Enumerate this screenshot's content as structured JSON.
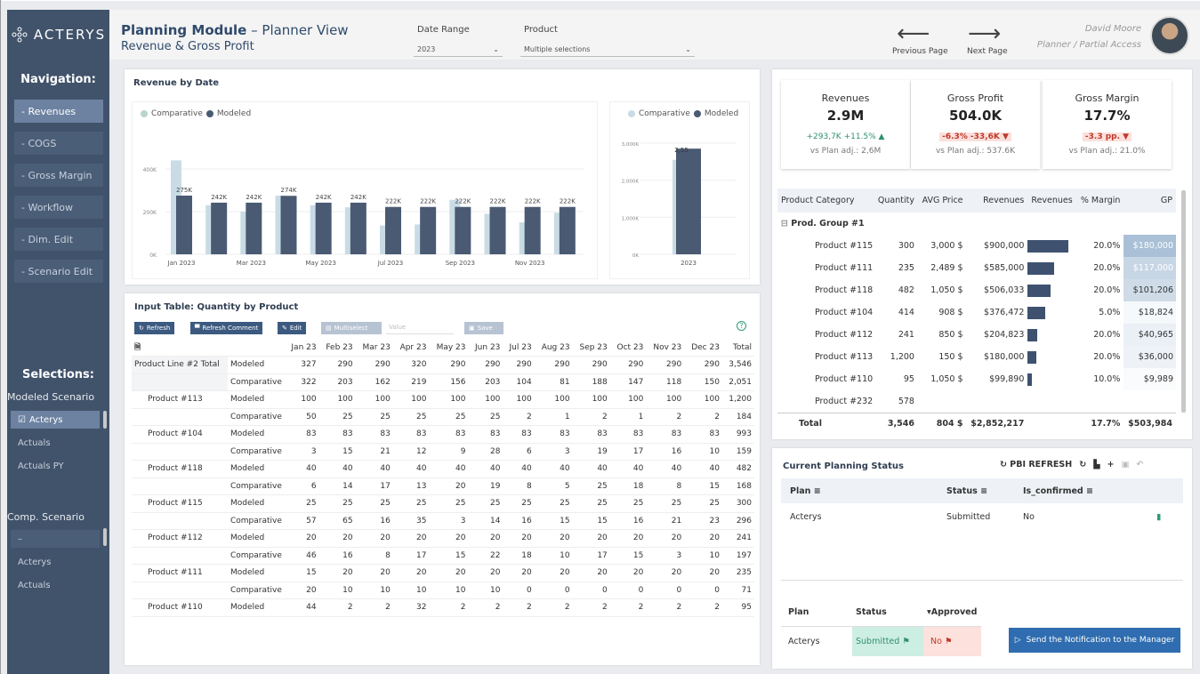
{
  "brand": {
    "name": "ACTERYS"
  },
  "header": {
    "title_bold": "Planning Module",
    "title_rest": " – Planner View",
    "subtitle": "Revenue & Gross Profit",
    "date_label": "Date Range",
    "date_value": "2023",
    "product_label": "Product",
    "product_value": "Multiple selections",
    "prev_label": "Previous Page",
    "next_label": "Next Page",
    "user_name": "David Moore",
    "user_role": "Planner / Partial Access"
  },
  "sidebar": {
    "nav_title": "Navigation:",
    "items": [
      "- Revenues",
      "- COGS",
      "- Gross Margin",
      "- Workflow",
      "- Dim. Edit",
      "- Scenario Edit"
    ],
    "sel_title": "Selections:",
    "modeled_label": "Modeled Scenario",
    "modeled_items": [
      "Acterys",
      "Actuals",
      "Actuals PY"
    ],
    "comp_label": "Comp. Scenario",
    "comp_items": [
      "–",
      "Acterys",
      "Actuals"
    ]
  },
  "revenue_chart": {
    "title": "Revenue by Date",
    "legend_comp": "Comparative",
    "legend_model": "Modeled"
  },
  "chart_data": [
    {
      "type": "bar",
      "title": "Revenue by Date",
      "categories": [
        "Jan 2023",
        "Feb 2023",
        "Mar 2023",
        "Apr 2023",
        "May 2023",
        "Jun 2023",
        "Jul 2023",
        "Aug 2023",
        "Sep 2023",
        "Oct 2023",
        "Nov 2023",
        "Dec 2023"
      ],
      "x_tick_labels": [
        "Jan 2023",
        "Mar 2023",
        "May 2023",
        "Jul 2023",
        "Sep 2023",
        "Nov 2023"
      ],
      "y_tick_labels": [
        "0K",
        "200K",
        "400K"
      ],
      "ylim": [
        0,
        500
      ],
      "series": [
        {
          "name": "Comparative",
          "color": "#c9dce6",
          "values": [
            440,
            230,
            200,
            275,
            230,
            220,
            135,
            140,
            255,
            190,
            150,
            195
          ]
        },
        {
          "name": "Modeled",
          "color": "#4a5a72",
          "values": [
            275,
            242,
            242,
            274,
            242,
            242,
            222,
            222,
            222,
            222,
            222,
            222
          ]
        }
      ],
      "data_labels": [
        "275K",
        "242K",
        "242K",
        "274K",
        "242K",
        "242K",
        "222K",
        "222K",
        "222K",
        "222K",
        "222K",
        "222K"
      ]
    },
    {
      "type": "bar",
      "categories": [
        "2023"
      ],
      "y_tick_labels": [
        "0K",
        "1,000K",
        "2,000K",
        "3,000K"
      ],
      "ylim": [
        0,
        3000
      ],
      "series": [
        {
          "name": "Comparative",
          "color": "#c9dce6",
          "values": [
            2550
          ]
        },
        {
          "name": "Modeled",
          "color": "#4a5a72",
          "values": [
            2852
          ]
        }
      ],
      "data_labels": [
        "2,55"
      ]
    }
  ],
  "kpis": [
    {
      "title": "Revenues",
      "value": "2.9M",
      "delta": "+293,7K +11.5% ▲",
      "plan": "vs Plan adj.: 2,6M",
      "dir": "up"
    },
    {
      "title": "Gross Profit",
      "value": "504.0K",
      "delta": "-6.3% -33,6K ▼",
      "plan": "vs Plan adj.: 537.6K",
      "dir": "down"
    },
    {
      "title": "Gross Margin",
      "value": "17.7%",
      "delta": "-3.3 pp.  ▼",
      "plan": "vs Plan adj.: 21.0%",
      "dir": "down"
    }
  ],
  "product_table": {
    "headers": [
      "Product Category",
      "Quantity",
      "AVG Price",
      "Revenues",
      "Revenues",
      "% Margin",
      "GP"
    ],
    "group": "Prod. Group #1",
    "rows": [
      [
        "Product #115",
        "300",
        "3,000 $",
        "$900,000",
        1.0,
        "20.0%",
        "$180,000",
        1.0
      ],
      [
        "Product #111",
        "235",
        "2,489 $",
        "$585,000",
        0.65,
        "20.0%",
        "$117,000",
        0.65
      ],
      [
        "Product #118",
        "482",
        "1,050 $",
        "$506,033",
        0.56,
        "20.0%",
        "$101,206",
        0.56
      ],
      [
        "Product #104",
        "414",
        "908 $",
        "$376,472",
        0.42,
        "5.0%",
        "$18,824",
        0.1
      ],
      [
        "Product #112",
        "241",
        "850 $",
        "$204,823",
        0.23,
        "20.0%",
        "$40,965",
        0.23
      ],
      [
        "Product #113",
        "1,200",
        "150 $",
        "$180,000",
        0.2,
        "20.0%",
        "$36,000",
        0.2
      ],
      [
        "Product #110",
        "95",
        "1,050 $",
        "$99,890",
        0.11,
        "10.0%",
        "$9,989",
        0.06
      ],
      [
        "Product #232",
        "578",
        "",
        "",
        0,
        "",
        "",
        0
      ]
    ],
    "total": [
      "Total",
      "3,546",
      "804 $",
      "$2,852,217",
      "",
      "17.7%",
      "$503,984"
    ]
  },
  "input_table": {
    "title": "Input Table: Quantity by Product",
    "buttons": [
      "Refresh",
      "Refresh Comment",
      "Edit",
      "Multiselect",
      "Value",
      "Save"
    ],
    "headers": [
      "Jan 23",
      "Feb 23",
      "Mar 23",
      "Apr 23",
      "May 23",
      "Jun 23",
      "Jul 23",
      "Aug 23",
      "Sep 23",
      "Oct 23",
      "Nov 23",
      "Dec 23",
      "Total"
    ],
    "rows": [
      [
        "Product Line #2 Total",
        "Modeled",
        [
          "327",
          "290",
          "290",
          "320",
          "290",
          "290",
          "290",
          "290",
          "290",
          "290",
          "290",
          "290",
          "3,546"
        ]
      ],
      [
        "",
        "Comparative",
        [
          "322",
          "203",
          "162",
          "219",
          "156",
          "203",
          "104",
          "81",
          "188",
          "147",
          "118",
          "150",
          "2,051"
        ]
      ],
      [
        "Product #113",
        "Modeled",
        [
          "100",
          "100",
          "100",
          "100",
          "100",
          "100",
          "100",
          "100",
          "100",
          "100",
          "100",
          "100",
          "1,200"
        ]
      ],
      [
        "",
        "Comparative",
        [
          "50",
          "25",
          "25",
          "25",
          "25",
          "25",
          "2",
          "1",
          "2",
          "1",
          "2",
          "2",
          "184"
        ]
      ],
      [
        "Product #104",
        "Modeled",
        [
          "83",
          "83",
          "83",
          "83",
          "83",
          "83",
          "83",
          "83",
          "83",
          "83",
          "83",
          "83",
          "993"
        ]
      ],
      [
        "",
        "Comparative",
        [
          "3",
          "15",
          "21",
          "12",
          "9",
          "28",
          "6",
          "3",
          "19",
          "17",
          "16",
          "10",
          "159"
        ]
      ],
      [
        "Product #118",
        "Modeled",
        [
          "40",
          "40",
          "40",
          "40",
          "40",
          "40",
          "40",
          "40",
          "40",
          "40",
          "40",
          "40",
          "482"
        ]
      ],
      [
        "",
        "Comparative",
        [
          "6",
          "14",
          "17",
          "13",
          "20",
          "19",
          "8",
          "5",
          "25",
          "18",
          "8",
          "15",
          "168"
        ]
      ],
      [
        "Product #115",
        "Modeled",
        [
          "25",
          "25",
          "25",
          "25",
          "25",
          "25",
          "25",
          "25",
          "25",
          "25",
          "25",
          "25",
          "300"
        ]
      ],
      [
        "",
        "Comparative",
        [
          "57",
          "65",
          "16",
          "35",
          "3",
          "14",
          "16",
          "15",
          "15",
          "16",
          "21",
          "23",
          "296"
        ]
      ],
      [
        "Product #112",
        "Modeled",
        [
          "20",
          "20",
          "20",
          "20",
          "20",
          "20",
          "20",
          "20",
          "20",
          "20",
          "20",
          "20",
          "241"
        ]
      ],
      [
        "",
        "Comparative",
        [
          "46",
          "16",
          "8",
          "17",
          "15",
          "22",
          "18",
          "10",
          "17",
          "15",
          "3",
          "10",
          "197"
        ]
      ],
      [
        "Product #111",
        "Modeled",
        [
          "15",
          "20",
          "20",
          "20",
          "20",
          "20",
          "20",
          "20",
          "20",
          "20",
          "20",
          "20",
          "235"
        ]
      ],
      [
        "",
        "Comparative",
        [
          "20",
          "10",
          "10",
          "10",
          "10",
          "10",
          "0",
          "0",
          "0",
          "0",
          "0",
          "0",
          "71"
        ]
      ],
      [
        "Product #110",
        "Modeled",
        [
          "44",
          "2",
          "2",
          "32",
          "2",
          "2",
          "2",
          "2",
          "2",
          "2",
          "2",
          "2",
          "95"
        ]
      ]
    ]
  },
  "planning": {
    "title": "Current Planning Status",
    "refresh": "PBI REFRESH",
    "headers": [
      "Plan",
      "Status",
      "Is_confirmed"
    ],
    "row": [
      "Acterys",
      "Submitted",
      "No"
    ]
  },
  "approval": {
    "headers": [
      "Plan",
      "Status",
      "Approved"
    ],
    "row": [
      "Acterys",
      "Submitted",
      "No"
    ],
    "send": "Send the Notification to the Manager"
  }
}
